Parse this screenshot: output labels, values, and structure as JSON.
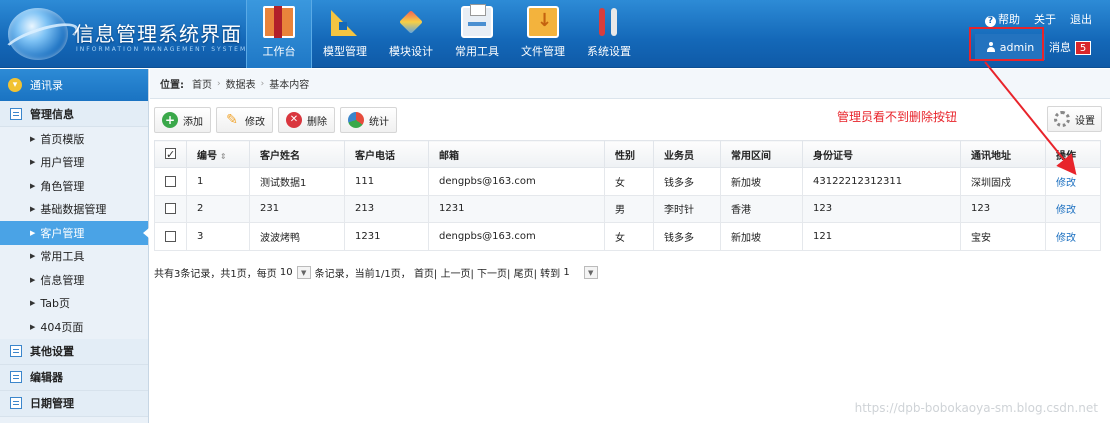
{
  "header": {
    "title": "信息管理系统界面",
    "subtitle": "INFORMATION MANAGEMENT SYSTEM GUI",
    "nav": [
      "工作台",
      "模型管理",
      "模块设计",
      "常用工具",
      "文件管理",
      "系统设置"
    ],
    "links": {
      "help": "帮助",
      "about": "关于",
      "exit": "退出"
    },
    "user": "admin",
    "messages_label": "消息",
    "messages_count": "5"
  },
  "sidebar": {
    "head": "通讯录",
    "groups": [
      {
        "label": "管理信息",
        "items": [
          "首页模版",
          "用户管理",
          "角色管理",
          "基础数据管理",
          "客户管理",
          "常用工具",
          "信息管理",
          "Tab页",
          "404页面"
        ]
      },
      {
        "label": "其他设置"
      },
      {
        "label": "编辑器"
      },
      {
        "label": "日期管理"
      }
    ]
  },
  "breadcrumb": {
    "label": "位置:",
    "items": [
      "首页",
      "数据表",
      "基本内容"
    ]
  },
  "toolbar": {
    "add": "添加",
    "edit": "修改",
    "delete": "删除",
    "stats": "统计",
    "settings": "设置"
  },
  "annotation": "管理员看不到删除按钮",
  "table": {
    "headers": [
      "编号",
      "客户姓名",
      "客户电话",
      "邮箱",
      "性别",
      "业务员",
      "常用区间",
      "身份证号",
      "通讯地址",
      "操作"
    ],
    "rows": [
      [
        "1",
        "测试数据1",
        "111",
        "dengpbs@163.com",
        "女",
        "钱多多",
        "新加坡",
        "43122212312311",
        "深圳固戍",
        "修改"
      ],
      [
        "2",
        "231",
        "213",
        "1231",
        "男",
        "李时针",
        "香港",
        "123",
        "123",
        "修改"
      ],
      [
        "3",
        "波波烤鸭",
        "1231",
        "dengpbs@163.com",
        "女",
        "钱多多",
        "新加坡",
        "121",
        "宝安",
        "修改"
      ]
    ]
  },
  "pager": {
    "text1": "共有3条记录，共1页，每页",
    "page_size": "10",
    "text2": "条记录，当前1/1页，",
    "nav": "首页| 上一页| 下一页| 尾页| 转到",
    "goto": "1"
  },
  "watermark": "https://dpb-bobokaoya-sm.blog.csdn.net"
}
